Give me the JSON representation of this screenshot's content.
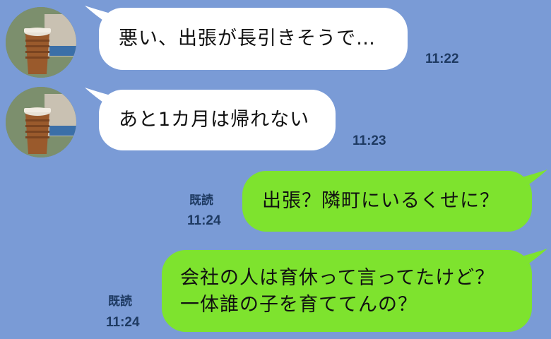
{
  "messages": [
    {
      "direction": "incoming",
      "text": "悪い、出張が長引きそうで…",
      "time": "11:22"
    },
    {
      "direction": "incoming",
      "text": "あと1カ月は帰れない",
      "time": "11:23"
    },
    {
      "direction": "outgoing",
      "text": "出張？隣町にいるくせに？",
      "read": "既読",
      "time": "11:24"
    },
    {
      "direction": "outgoing",
      "lines": [
        "会社の人は育休って言ってたけど？",
        "一体誰の子を育ててんの？"
      ],
      "read": "既読",
      "time": "11:24"
    }
  ],
  "colors": {
    "background": "#7a9bd6",
    "incoming_bubble": "#ffffff",
    "outgoing_bubble": "#7ee32e"
  },
  "avatar_icon": "coffee-cup-icon"
}
